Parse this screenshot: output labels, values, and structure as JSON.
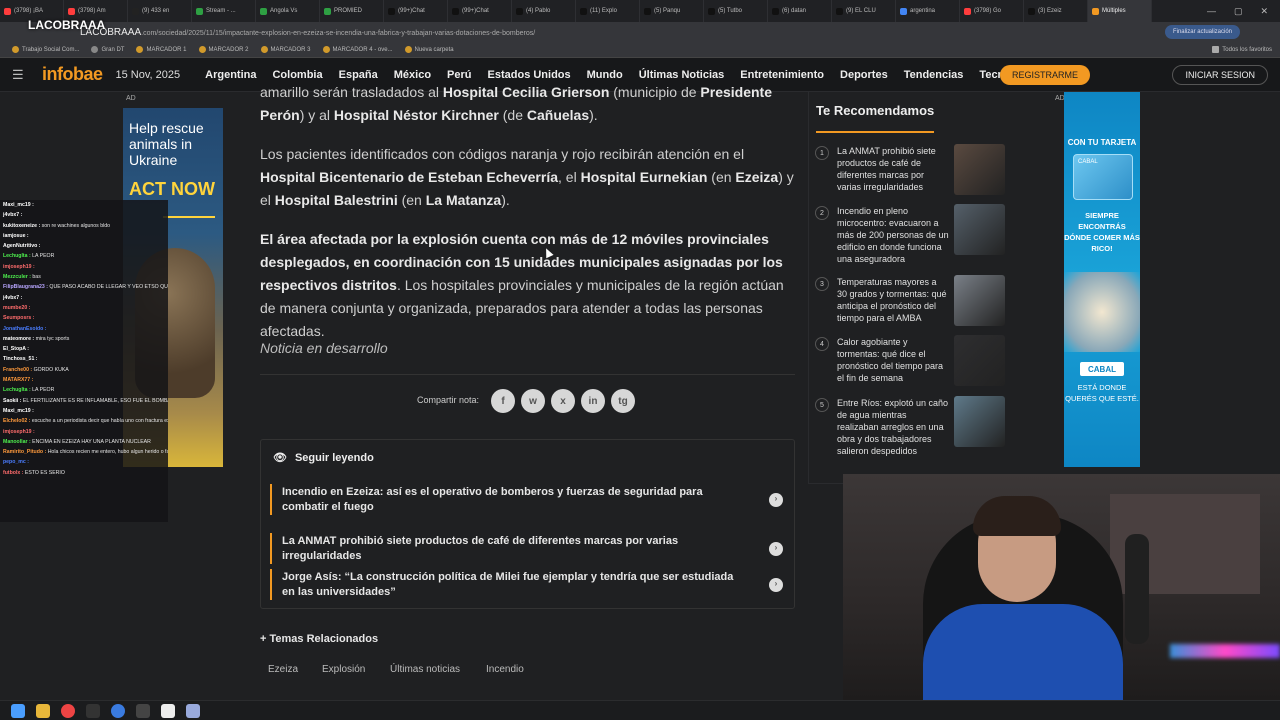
{
  "browser": {
    "tabs": [
      {
        "label": "(3798) ¡BA",
        "color": "#ff3d3d"
      },
      {
        "label": "(3798) Am",
        "color": "#ff3d3d"
      },
      {
        "label": "(9) 433 en",
        "color": "#222"
      },
      {
        "label": "Stream - ...",
        "color": "#2ea043"
      },
      {
        "label": "Angola Vs",
        "color": "#2ea043"
      },
      {
        "label": "PROMIED",
        "color": "#2ea043"
      },
      {
        "label": "(99+)Chat",
        "color": "#111"
      },
      {
        "label": "(99+)Chat",
        "color": "#111"
      },
      {
        "label": "(4) Pablo",
        "color": "#111"
      },
      {
        "label": "(11) Explo",
        "color": "#111"
      },
      {
        "label": "(5) Panqu",
        "color": "#111"
      },
      {
        "label": "(5) Tutbo",
        "color": "#111"
      },
      {
        "label": "(6) datan",
        "color": "#111"
      },
      {
        "label": "(9) EL CLU",
        "color": "#111"
      },
      {
        "label": "argentina",
        "color": "#4285f4"
      },
      {
        "label": "(3798) Go",
        "color": "#ff3d3d"
      },
      {
        "label": "(3) Ezeiz",
        "color": "#111"
      },
      {
        "label": "Múltiples",
        "color": "#f29922"
      }
    ],
    "url_host": "LACOBRAAA",
    "url_path": ".com/sociedad/2025/11/15/impactante-explosion-en-ezeiza-se-incendia-una-fabrica-y-trabajan-varias-dotaciones-de-bomberos/",
    "update_button": "Finalizar actualización",
    "bookmarks": [
      "Trabajo Social Com...",
      "Gran DT",
      "MARCADOR 1",
      "MARCADOR 2",
      "MARCADOR 3",
      "MARCADOR 4 - ove...",
      "Nueva carpeta"
    ],
    "all_bookmarks": "Todos los favoritos"
  },
  "site": {
    "logo": "infobae",
    "date": "15 Nov, 2025",
    "nav": [
      "Argentina",
      "Colombia",
      "España",
      "México",
      "Perú",
      "Estados Unidos",
      "Mundo",
      "Últimas Noticias",
      "Entretenimiento",
      "Deportes",
      "Tendencias",
      "Tecno"
    ],
    "register": "REGISTRARME",
    "login": "INICIAR SESION"
  },
  "article": {
    "p1_a": "amarillo serán trasladados al ",
    "p1_b": "Hospital Cecilia Grierson",
    "p1_c": " (municipio de ",
    "p1_d": "Presidente Perón",
    "p1_e": ") y al ",
    "p1_f": "Hospital Néstor Kirchner",
    "p1_g": " (de ",
    "p1_h": "Cañuelas",
    "p1_i": ").",
    "p2_a": "Los pacientes identificados con códigos naranja y rojo recibirán atención en el ",
    "p2_b": "Hospital Bicentenario de Esteban Echeverría",
    "p2_c": ", el ",
    "p2_d": "Hospital Eurnekian",
    "p2_e": " (en ",
    "p2_f": "Ezeiza",
    "p2_g": ") y el ",
    "p2_h": "Hospital Balestrini",
    "p2_i": " (en ",
    "p2_j": "La Matanza",
    "p2_k": ").",
    "p3_a": "El área afectada por la explosión cuenta con más de 12 móviles provinciales desplegados, en coordinación con 15 unidades municipales asignadas por los respectivos distritos",
    "p3_b": ". Los hospitales provinciales y municipales de la región actúan de manera conjunta y organizada, preparados para atender a todas las personas afectadas.",
    "p4": "Noticia en desarrollo",
    "share_label": "Compartir nota:",
    "share_icons": [
      "f",
      "w",
      "x",
      "in",
      "tg"
    ]
  },
  "keep_reading": {
    "title": "Seguir leyendo",
    "items": [
      "Incendio en Ezeiza: así es el operativo de bomberos y fuerzas de seguridad para combatir el fuego",
      "La ANMAT prohibió siete productos de café de diferentes marcas por varias irregularidades",
      "Jorge Asís: “La construcción política de Milei fue ejemplar y tendría que ser estudiada en las universidades”"
    ]
  },
  "topics": {
    "title": "Temas Relacionados",
    "items": [
      "Ezeiza",
      "Explosión",
      "Últimas noticias",
      "Incendio"
    ]
  },
  "recommendations": {
    "title": "Te Recomendamos",
    "items": [
      {
        "num": "1",
        "text": "La ANMAT prohibió siete productos de café de diferentes marcas por varias irregularidades",
        "thumb": "#5a4a40"
      },
      {
        "num": "2",
        "text": "Incendio en pleno microcentro: evacuaron a más de 200 personas de un edificio en donde funciona una aseguradora",
        "thumb": "#55606a"
      },
      {
        "num": "3",
        "text": "Temperaturas mayores a 30 grados y tormentas: qué anticipa el pronóstico del tiempo para el AMBA",
        "thumb": "#7a8088"
      },
      {
        "num": "4",
        "text": "Calor agobiante y tormentas: qué dice el pronóstico del tiempo para el fin de semana",
        "thumb": "#2e2e30"
      },
      {
        "num": "5",
        "text": "Entre Ríos: explotó un caño de agua mientras realizaban arreglos en una obra y dos trabajadores salieron despedidos",
        "thumb": "#5f7a8a"
      }
    ]
  },
  "ads": {
    "label": "AD",
    "left_line1": "Help rescue animals in",
    "left_line2": "Ukraine",
    "left_cta": "ACT NOW",
    "right_line1": "CON TU TARJETA",
    "right_card": "CABAL",
    "right_line2": "SIEMPRE ENCONTRÁS DÓNDE COMER MÁS RICO!",
    "right_logo": "CABAL",
    "right_line3": "ESTÁ DONDE QUERÉS QUE ESTÉ."
  },
  "chat": [
    {
      "user": "Maxi_mc19 :",
      "msg": "",
      "color": "#ffffff"
    },
    {
      "user": "j4vbx7 :",
      "msg": "",
      "color": "#ffffff"
    },
    {
      "user": "kukitoxeneize :",
      "msg": "son re wachines algunos bldo",
      "color": "#ffffff"
    },
    {
      "user": "iamjosue :",
      "msg": "",
      "color": "#ffffff"
    },
    {
      "user": "AgenNutritivo :",
      "msg": "",
      "color": "#ffffff"
    },
    {
      "user": "Lechuglta :",
      "msg": "LA PEOR",
      "color": "#4ef04e"
    },
    {
      "user": "imjoseph19 :",
      "msg": "",
      "color": "#ff6c6c"
    },
    {
      "user": "Mezzculer :",
      "msg": "bas",
      "color": "#4ef04e"
    },
    {
      "user": "FilipBlaugrana23 :",
      "msg": "QUE PASO ACABO DE LLEGAR Y VEO ETSO QUE ESTA PASANDO",
      "color": "#b8a6ff"
    },
    {
      "user": "j4vbx7 :",
      "msg": "",
      "color": "#ffffff"
    },
    {
      "user": "mumbe20 :",
      "msg": "",
      "color": "#ff6c6c"
    },
    {
      "user": "Seumposrs :",
      "msg": "",
      "color": "#ff6c6c"
    },
    {
      "user": "JonathanEsoido :",
      "msg": "",
      "color": "#4a7dff"
    },
    {
      "user": "mateomore :",
      "msg": "mira tyc sports",
      "color": "#ffffff"
    },
    {
      "user": "El_StopA :",
      "msg": "",
      "color": "#ffffff"
    },
    {
      "user": "Tinchoss_51 :",
      "msg": "",
      "color": "#ffffff"
    },
    {
      "user": "Franche00 :",
      "msg": "GORDO KUKA",
      "color": "#ff9a3c"
    },
    {
      "user": "MATARX77 :",
      "msg": "",
      "color": "#ff9a3c"
    },
    {
      "user": "Lechuglta :",
      "msg": "LA PEOR",
      "color": "#4ef04e"
    },
    {
      "user": "Saokii :",
      "msg": "EL FERTILIZANTE ES RE INFLAMABLE, ESO FUE EL BOMBAZO",
      "color": "#ffffff"
    },
    {
      "user": "Maxi_mc19 :",
      "msg": "",
      "color": "#ffffff"
    },
    {
      "user": "Elchelo02 :",
      "msg": "escuche a un periodista decir que había uno con fractura expuesta en un brazo",
      "color": "#ff9a3c"
    },
    {
      "user": "imjoseph19 :",
      "msg": "",
      "color": "#ff6c6c"
    },
    {
      "user": "Manoollar :",
      "msg": "ENCIMA EN EZEIZA HAY UNA PLANTA NUCLEAR",
      "color": "#4ef04e"
    },
    {
      "user": "Ramirito_Pitudo :",
      "msg": "Hola chicos recien me entero, hubo algun herido o fallecidos ?",
      "color": "#ff9a3c"
    },
    {
      "user": "pepo_mc :",
      "msg": "",
      "color": "#4a7dff"
    },
    {
      "user": "futbolx :",
      "msg": "ESTO ES SERIO",
      "color": "#ff6c6c"
    }
  ],
  "overlay": {
    "streamer_logo": "LACOBRAAA"
  },
  "taskbar": {
    "icons": [
      {
        "name": "windows-start-icon",
        "color": "#4a9eff"
      },
      {
        "name": "file-explorer-icon",
        "color": "#e8b73a"
      },
      {
        "name": "chrome-icon",
        "color": "#e44"
      },
      {
        "name": "obs-icon",
        "color": "#333"
      },
      {
        "name": "chrome-alt-icon",
        "color": "#3a7be0"
      },
      {
        "name": "app-icon",
        "color": "#444"
      },
      {
        "name": "terminal-icon",
        "color": "#eee"
      },
      {
        "name": "notes-icon",
        "color": "#9ad"
      }
    ]
  }
}
